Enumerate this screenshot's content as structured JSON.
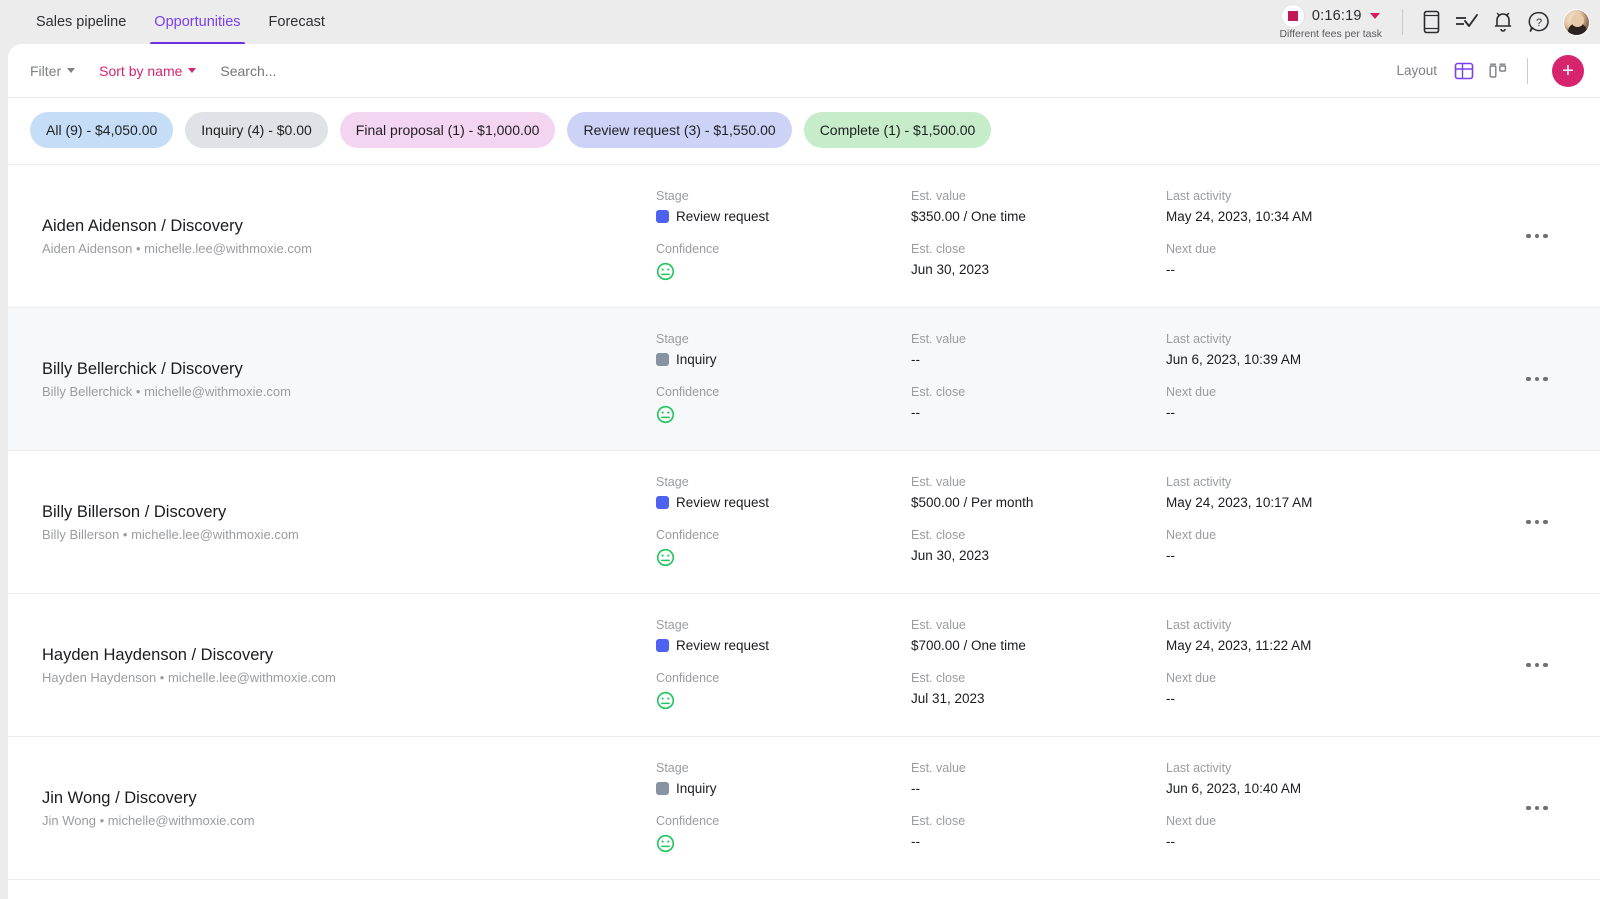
{
  "header": {
    "tabs": [
      {
        "label": "Sales pipeline",
        "active": false
      },
      {
        "label": "Opportunities",
        "active": true
      },
      {
        "label": "Forecast",
        "active": false
      }
    ],
    "timer": {
      "time": "0:16:19",
      "subtitle": "Different fees per task",
      "stop_icon": "stop-square-icon",
      "caret_icon": "chevron-down-icon"
    },
    "icons": [
      {
        "name": "mobile-device-icon"
      },
      {
        "name": "tasks-checklist-icon"
      },
      {
        "name": "notifications-bell-icon"
      },
      {
        "name": "help-question-icon"
      }
    ],
    "avatar": "user-avatar"
  },
  "toolbar": {
    "filter_label": "Filter",
    "sort_label": "Sort by name",
    "search_placeholder": "Search...",
    "search_value": "",
    "layout_label": "Layout",
    "layout_table_icon": "table-layout-icon",
    "layout_board_icon": "board-layout-icon",
    "add_label": "+",
    "accent_color": "#d6246e",
    "active_layout_color": "#7b3ff2"
  },
  "chips": [
    {
      "label": "All (9) - $4,050.00",
      "bg": "#c5ddf7",
      "fg": "#1f2023"
    },
    {
      "label": "Inquiry (4) - $0.00",
      "bg": "#dfe2e6",
      "fg": "#1f2023"
    },
    {
      "label": "Final proposal (1) - $1,000.00",
      "bg": "#f3d4f1",
      "fg": "#1f2023"
    },
    {
      "label": "Review request (3) - $1,550.00",
      "bg": "#cdd3f7",
      "fg": "#1f2023"
    },
    {
      "label": "Complete (1) - $1,500.00",
      "bg": "#c6ecc9",
      "fg": "#1f2023"
    }
  ],
  "labels": {
    "stage": "Stage",
    "confidence": "Confidence",
    "est_value": "Est. value",
    "est_close": "Est. close",
    "last_activity": "Last activity",
    "next_due": "Next due"
  },
  "stage_colors": {
    "Review request": "#4d62f0",
    "Inquiry": "#8793a3",
    "Final proposal": "#e0a6e0",
    "Complete": "#5fc46a"
  },
  "rows": [
    {
      "title": "Aiden Aidenson / Discovery",
      "subtitle": "Aiden Aidenson • michelle.lee@withmoxie.com",
      "stage": "Review request",
      "confidence": "neutral-face-icon",
      "est_value": "$350.00 / One time",
      "est_close": "Jun 30, 2023",
      "last_activity": "May 24, 2023, 10:34 AM",
      "next_due": "--",
      "highlighted": false
    },
    {
      "title": "Billy Bellerchick / Discovery",
      "subtitle": "Billy Bellerchick • michelle@withmoxie.com",
      "stage": "Inquiry",
      "confidence": "neutral-face-icon",
      "est_value": "--",
      "est_close": "--",
      "last_activity": "Jun 6, 2023, 10:39 AM",
      "next_due": "--",
      "highlighted": true
    },
    {
      "title": "Billy Billerson / Discovery",
      "subtitle": "Billy Billerson • michelle.lee@withmoxie.com",
      "stage": "Review request",
      "confidence": "neutral-face-icon",
      "est_value": "$500.00 / Per month",
      "est_close": "Jun 30, 2023",
      "last_activity": "May 24, 2023, 10:17 AM",
      "next_due": "--",
      "highlighted": false
    },
    {
      "title": "Hayden Haydenson / Discovery",
      "subtitle": "Hayden Haydenson • michelle.lee@withmoxie.com",
      "stage": "Review request",
      "confidence": "neutral-face-icon",
      "est_value": "$700.00 / One time",
      "est_close": "Jul 31, 2023",
      "last_activity": "May 24, 2023, 11:22 AM",
      "next_due": "--",
      "highlighted": false
    },
    {
      "title": "Jin Wong / Discovery",
      "subtitle": "Jin Wong • michelle@withmoxie.com",
      "stage": "Inquiry",
      "confidence": "neutral-face-icon",
      "est_value": "--",
      "est_close": "--",
      "last_activity": "Jun 6, 2023, 10:40 AM",
      "next_due": "--",
      "highlighted": false
    }
  ]
}
